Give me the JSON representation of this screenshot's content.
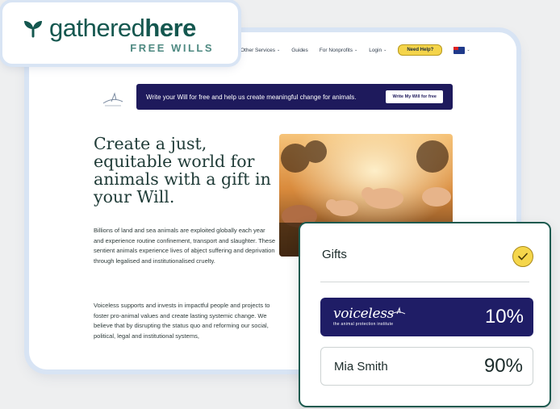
{
  "brand": {
    "name_regular": "gathered",
    "name_bold": "here",
    "subtitle": "FREE WILLS"
  },
  "nav": {
    "items": [
      "Other Services",
      "Guides",
      "For Nonprofits",
      "Login"
    ],
    "help_label": "Need Help?"
  },
  "banner": {
    "text": "Write your Will for free and help us create meaningful change for animals.",
    "button_label": "Write My Will for free"
  },
  "hero": {
    "title": "Create a just, equitable world for animals with a gift in your Will.",
    "paragraphs": [
      "Billions of land and sea animals are exploited globally each year and experience routine confinement, transport and slaughter. These sentient animals experience lives of abject suffering and deprivation through legalised and institutionalised cruelty.",
      "Voiceless supports and invests in impactful people and projects to foster pro-animal values and create lasting systemic change. We believe that by disrupting the status quo and reforming our social, political, legal and institutional systems,"
    ]
  },
  "gifts": {
    "title": "Gifts",
    "rows": [
      {
        "name": "voiceless",
        "tagline": "the animal protection institute",
        "percent": "10%"
      },
      {
        "name": "Mia Smith",
        "percent": "90%"
      }
    ]
  },
  "colors": {
    "brand_green": "#14574f",
    "banner_navy": "#1e1a5c",
    "accent_yellow": "#f5d64b"
  },
  "icons": [
    "sprout-logo-icon",
    "chevron-down-icon",
    "flag-icon",
    "check-icon",
    "bird-logo-icon"
  ]
}
